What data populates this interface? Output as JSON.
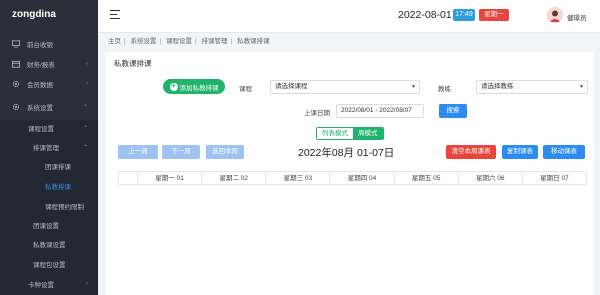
{
  "sidebar": {
    "brand": "zongdina",
    "items": [
      {
        "label": "前台收银",
        "icon": "monitor-icon"
      },
      {
        "label": "财务/报表",
        "icon": "wallet-icon",
        "arrow": "‹"
      },
      {
        "label": "会员数据",
        "icon": "gear-icon",
        "arrow": "‹"
      },
      {
        "label": "系统设置",
        "icon": "gear-icon",
        "arrow": "⌃"
      },
      {
        "label": "课程设置",
        "arrow": "⌃"
      },
      {
        "label": "排课管理",
        "arrow": "⌃"
      },
      {
        "label": "团课排课"
      },
      {
        "label": "私教排课"
      },
      {
        "label": "课程预约限制"
      },
      {
        "label": "团课设置"
      },
      {
        "label": "私教课设置"
      },
      {
        "label": "课程包设置"
      },
      {
        "label": "卡种设置",
        "arrow": "‹"
      }
    ]
  },
  "header": {
    "date": "2022-08-01",
    "time": "17:49",
    "weekday": "星期一",
    "username": "健璟员"
  },
  "breadcrumb": [
    "主页",
    "系统设置",
    "课程设置",
    "排课管理",
    "私教课排课"
  ],
  "panel": {
    "title": "私教课排课",
    "add_button": "添加私教排课",
    "course_label": "课程",
    "course_select": "请选择课程",
    "coach_label": "教练",
    "coach_select": "请选择教练",
    "date_label": "上课日期",
    "date_range": "2022/08/01 - 2022/08/07",
    "search_button": "搜索",
    "view_list": "列表模式",
    "view_week": "周模式",
    "prev_week": "上一周",
    "next_week": "下一周",
    "this_week": "返回本周",
    "week_title": "2022年08月 01-07日",
    "clear_button": "清空本周课表",
    "copy_button": "复制课表",
    "move_button": "移动课表",
    "columns": [
      "",
      "星期一 01",
      "星期二 02",
      "星期三 03",
      "星期四 04",
      "星期五 05",
      "星期六 06",
      "星期日 07"
    ]
  },
  "colors": {
    "sidebar": "#2b2f3a",
    "green": "#1fb36c",
    "blue": "#2d8cf0",
    "red": "#e8453c",
    "cyan": "#2aa0d8"
  }
}
